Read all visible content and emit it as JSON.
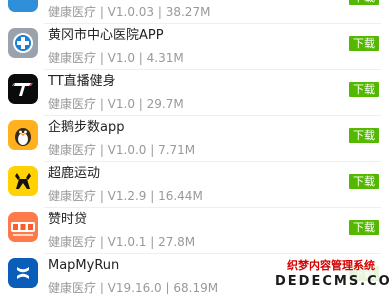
{
  "colors": {
    "download_button": "#55b800",
    "meta_text": "#999999",
    "name_text": "#222222",
    "watermark_red": "#d40000"
  },
  "download_label": "下载",
  "apps": [
    {
      "name": "",
      "meta": "健康医疗 | V1.0.03 | 38.27M",
      "icon": "partial-app-icon"
    },
    {
      "name": "黄冈市中心医院APP",
      "meta": "健康医疗 | V1.0 | 4.31M",
      "icon": "medical-cross-icon"
    },
    {
      "name": "TT直播健身",
      "meta": "健康医疗 | V1.0 | 29.7M",
      "icon": "tt-logo-icon"
    },
    {
      "name": "企鹅步数app",
      "meta": "健康医疗 | V1.0.0 | 7.71M",
      "icon": "penguin-icon"
    },
    {
      "name": "超鹿运动",
      "meta": "健康医疗 | V1.2.9 | 16.44M",
      "icon": "deer-icon"
    },
    {
      "name": "赞时贷",
      "meta": "健康医疗 | V1.0.1 | 27.8M",
      "icon": "zanshidai-logo-icon"
    },
    {
      "name": "MapMyRun",
      "meta": "健康医疗 | V19.16.0 | 68.19M",
      "icon": "under-armour-icon"
    }
  ],
  "watermark": {
    "line1": "织梦内容管理系统",
    "line2": "DEDECMS.COM"
  }
}
